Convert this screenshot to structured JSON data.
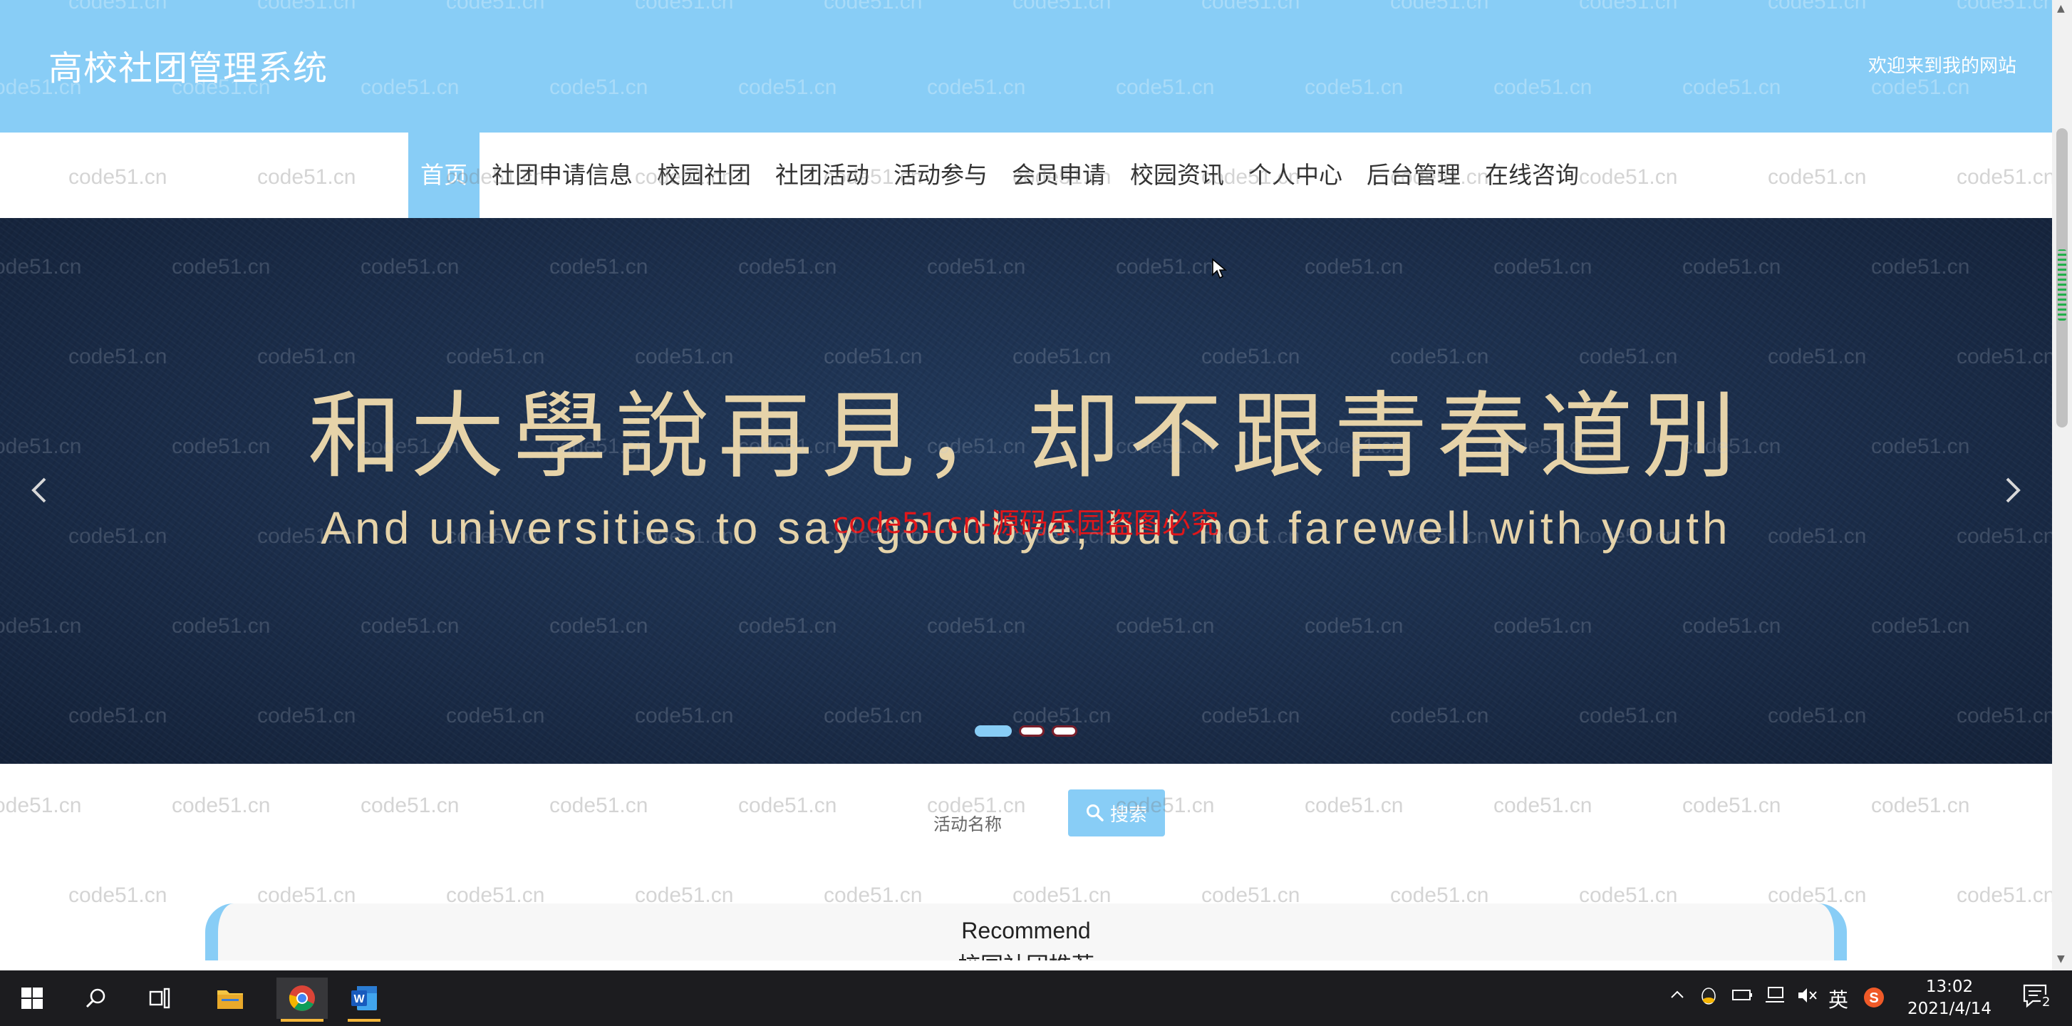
{
  "header": {
    "site_title": "高校社团管理系统",
    "welcome": "欢迎来到我的网站"
  },
  "nav": {
    "items": [
      "首页",
      "社团申请信息",
      "校园社团",
      "社团活动",
      "活动参与",
      "会员申请",
      "校园资讯",
      "个人中心",
      "后台管理",
      "在线咨询"
    ],
    "active_index": 0
  },
  "banner": {
    "headline_cn": "和大學說再見，却不跟青春道別",
    "headline_en": "And universities to say goodbye, but not farewell with youth",
    "overlay_watermark": "code51.cn-源码乐园盗图必究",
    "slide_count": 3,
    "active_slide": 0,
    "prev_icon": "chevron-left-icon",
    "next_icon": "chevron-right-icon"
  },
  "search": {
    "placeholder": "活动名称",
    "button_label": "搜索",
    "button_icon": "search-icon"
  },
  "recommend": {
    "title_en": "Recommend",
    "title_cn": "校园社团推荐"
  },
  "watermark_text": "code51.cn",
  "taskbar": {
    "time": "13:02",
    "date": "2021/4/14",
    "ime": "英",
    "notification_count": "2",
    "apps": [
      "windows-start-icon",
      "search-icon",
      "task-view-icon",
      "file-explorer-icon",
      "chrome-icon",
      "word-icon"
    ]
  },
  "colors": {
    "accent": "#88cdf6",
    "banner_bg": "#1b2d4a",
    "banner_text": "#e6d3a9",
    "watermark_red": "#e0161a",
    "taskbar_bg": "#1c1c1f"
  }
}
